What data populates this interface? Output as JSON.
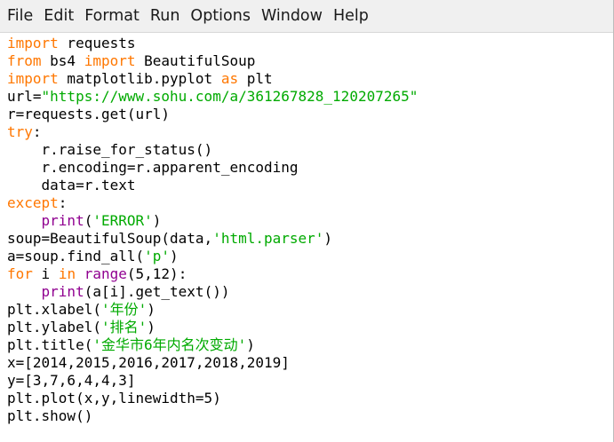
{
  "menu": {
    "file": "File",
    "edit": "Edit",
    "format": "Format",
    "run": "Run",
    "options": "Options",
    "window": "Window",
    "help": "Help"
  },
  "code": {
    "lines": [
      [
        {
          "t": "import",
          "c": "kw"
        },
        {
          "t": " requests"
        }
      ],
      [
        {
          "t": "from",
          "c": "kw"
        },
        {
          "t": " bs4 "
        },
        {
          "t": "import",
          "c": "kw"
        },
        {
          "t": " BeautifulSoup"
        }
      ],
      [
        {
          "t": "import",
          "c": "kw"
        },
        {
          "t": " matplotlib.pyplot "
        },
        {
          "t": "as",
          "c": "kw"
        },
        {
          "t": " plt"
        }
      ],
      [
        {
          "t": "url="
        },
        {
          "t": "\"https://www.sohu.com/a/361267828_120207265\"",
          "c": "str"
        }
      ],
      [
        {
          "t": "r=requests.get(url)"
        }
      ],
      [
        {
          "t": "try",
          "c": "kw"
        },
        {
          "t": ":"
        }
      ],
      [
        {
          "t": "    r.raise_for_status()"
        }
      ],
      [
        {
          "t": "    r.encoding=r.apparent_encoding"
        }
      ],
      [
        {
          "t": "    data=r.text"
        }
      ],
      [
        {
          "t": "except",
          "c": "kw"
        },
        {
          "t": ":"
        }
      ],
      [
        {
          "t": "    "
        },
        {
          "t": "print",
          "c": "bi"
        },
        {
          "t": "("
        },
        {
          "t": "'ERROR'",
          "c": "str"
        },
        {
          "t": ")"
        }
      ],
      [
        {
          "t": "soup=BeautifulSoup(data,"
        },
        {
          "t": "'html.parser'",
          "c": "str"
        },
        {
          "t": ")"
        }
      ],
      [
        {
          "t": "a=soup.find_all("
        },
        {
          "t": "'p'",
          "c": "str"
        },
        {
          "t": ")"
        }
      ],
      [
        {
          "t": "for",
          "c": "kw"
        },
        {
          "t": " i "
        },
        {
          "t": "in",
          "c": "kw"
        },
        {
          "t": " "
        },
        {
          "t": "range",
          "c": "bi"
        },
        {
          "t": "(5,12):"
        }
      ],
      [
        {
          "t": "    "
        },
        {
          "t": "print",
          "c": "bi"
        },
        {
          "t": "(a[i].get_text())"
        }
      ],
      [
        {
          "t": "plt.xlabel("
        },
        {
          "t": "'年份'",
          "c": "str"
        },
        {
          "t": ")"
        }
      ],
      [
        {
          "t": "plt.ylabel("
        },
        {
          "t": "'排名'",
          "c": "str"
        },
        {
          "t": ")"
        }
      ],
      [
        {
          "t": "plt.title("
        },
        {
          "t": "'金华市6年内名次变动'",
          "c": "str"
        },
        {
          "t": ")"
        }
      ],
      [
        {
          "t": "x=[2014,2015,2016,2017,2018,2019]"
        }
      ],
      [
        {
          "t": "y=[3,7,6,4,4,3]"
        }
      ],
      [
        {
          "t": "plt.plot(x,y,linewidth=5)"
        }
      ],
      [
        {
          "t": "plt.show()"
        }
      ]
    ]
  },
  "colors": {
    "keyword": "#ff7700",
    "builtin": "#900090",
    "string": "#00aa00",
    "text": "#000000",
    "menubar_bg": "#f0f0f0"
  }
}
